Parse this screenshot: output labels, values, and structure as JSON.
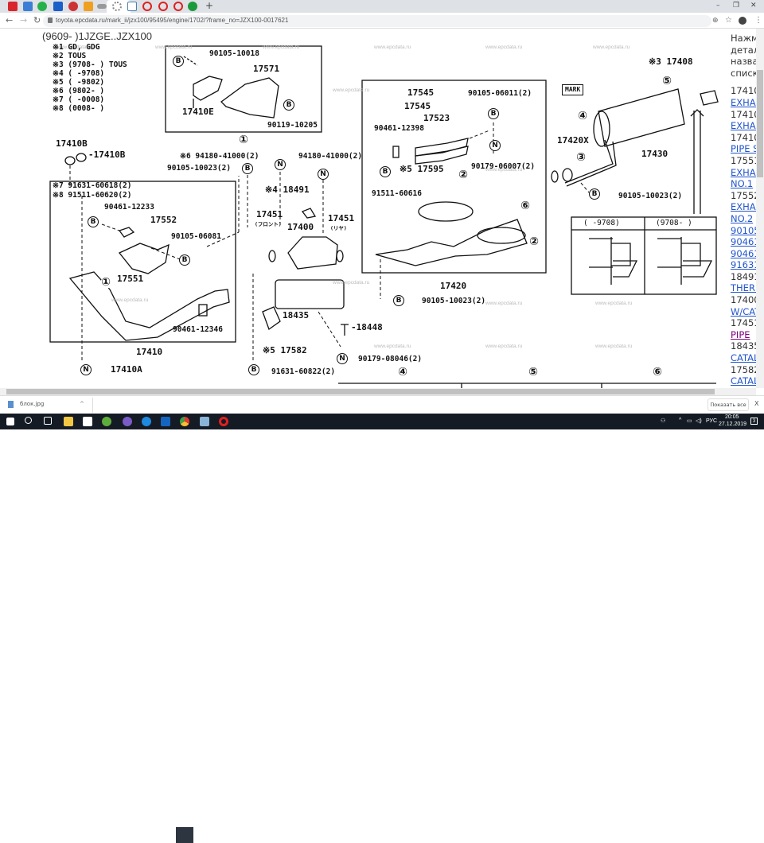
{
  "browser": {
    "url": "toyota.epcdata.ru/mark_ii/jzx100/95495/engine/1702/?frame_no=JZX100-0017621",
    "new_tab": "+",
    "controls": {
      "minimize": "–",
      "restore": "❐",
      "close": "✕"
    },
    "tab_icons": [
      "pdf-icon",
      "app-icon",
      "whatsapp-icon",
      "a-icon",
      "shield-icon",
      "bookmark-icon",
      "link-icon",
      "gear-icon",
      "g-icon",
      "target-icon",
      "target-icon",
      "target-icon",
      "circle-icon"
    ]
  },
  "page": {
    "heading": "(9609- )1JZGE..JZX100",
    "watermark": "www.epcdata.ru",
    "notes": [
      "※1 GD, GDG",
      "※2 TOUS",
      "※3 (9708-     ) TOUS",
      "※4 (      -9708)",
      "※5 (      -9802)",
      "※6 (9802-     )",
      "※7 (      -0008)",
      "※8 (0008-     )"
    ],
    "labels": {
      "l1": "90105-10018",
      "l2": "17571",
      "l3": "17410E",
      "l4": "90119-10205",
      "l5": "17410B",
      "l6": "-17410B",
      "l7": "※6 94180-41000(2)",
      "l8": "94180-41000(2)",
      "l9": "90105-10023(2)",
      "l10": "※7 91631-60618(2)",
      "l11": "※8 91511-60620(2)",
      "l12": "90461-12233",
      "l13": "17552",
      "l14": "90105-06081",
      "l15": "17551",
      "l16": "90461-12346",
      "l17": "17410",
      "l18": "17410A",
      "l19": "※4 18491",
      "l20": "17451",
      "l21": "(フロント)",
      "l22": "17400",
      "l23": "17451",
      "l24": "(リヤ)",
      "l25": "18435",
      "l26": "※5 17582",
      "l27": "-18448",
      "l28": "90179-08046(2)",
      "l29": "91631-60822(2)",
      "l30": "17545",
      "l31": "17545",
      "l32": "90105-06011(2)",
      "l33": "17523",
      "l34": "90461-12398",
      "l35": "※5 17595",
      "l36": "90179-06007(2)",
      "l37": "91511-60616",
      "l38": "17420",
      "l39": "90105-10023(2)",
      "l40": "※3 17408",
      "l41": "MARK",
      "l42": "17420X",
      "l43": "17430",
      "l44": "90105-10023(2)",
      "inset_left": "(      -9708)",
      "inset_right": "(9708-      )"
    },
    "callouts": {
      "b": "B",
      "n": "N",
      "c1": "①",
      "c2": "②",
      "c3": "③",
      "c4": "④",
      "c5": "⑤",
      "c6": "⑥"
    }
  },
  "sidebar": {
    "intro": [
      "Нажми",
      "детал",
      "назва",
      "списк"
    ],
    "items": [
      {
        "text": "17410",
        "link": false
      },
      {
        "text": "EXHAU",
        "link": true
      },
      {
        "text": "17410",
        "link": false
      },
      {
        "text": "EXHAU",
        "link": true
      },
      {
        "text": "17410",
        "link": false
      },
      {
        "text": "PIPE S",
        "link": true
      },
      {
        "text": "17551",
        "link": false
      },
      {
        "text": "EXHAU",
        "link": true
      },
      {
        "text": "NO.1",
        "link": true
      },
      {
        "text": "17552",
        "link": false
      },
      {
        "text": "EXHAU",
        "link": true
      },
      {
        "text": "NO.2",
        "link": true
      },
      {
        "text": "90105",
        "link": true
      },
      {
        "text": "90461",
        "link": true
      },
      {
        "text": "90461",
        "link": true
      },
      {
        "text": "91631",
        "link": true
      },
      {
        "text": "18491",
        "link": false
      },
      {
        "text": "THERM",
        "link": true
      },
      {
        "text": "17400",
        "link": false
      },
      {
        "text": "W/CAT",
        "link": true
      },
      {
        "text": "17451",
        "link": false
      },
      {
        "text": "PIPE",
        "link": true,
        "visited": true
      },
      {
        "text": "18435",
        "link": false
      },
      {
        "text": "CATAL",
        "link": true
      },
      {
        "text": "17582",
        "link": false
      },
      {
        "text": "CATAL",
        "link": true
      }
    ]
  },
  "downloads": {
    "file": "блок.jpg",
    "chevron": "^",
    "show_all": "Показать все",
    "close": "X"
  },
  "taskbar": {
    "lang": "РУС",
    "time": "20:05",
    "date": "27.12.2019",
    "notifications": "3"
  },
  "colors": {
    "link": "#2255cc",
    "visited": "#800080",
    "taskbar": "#141b24",
    "tabbar": "#dee1e6"
  }
}
